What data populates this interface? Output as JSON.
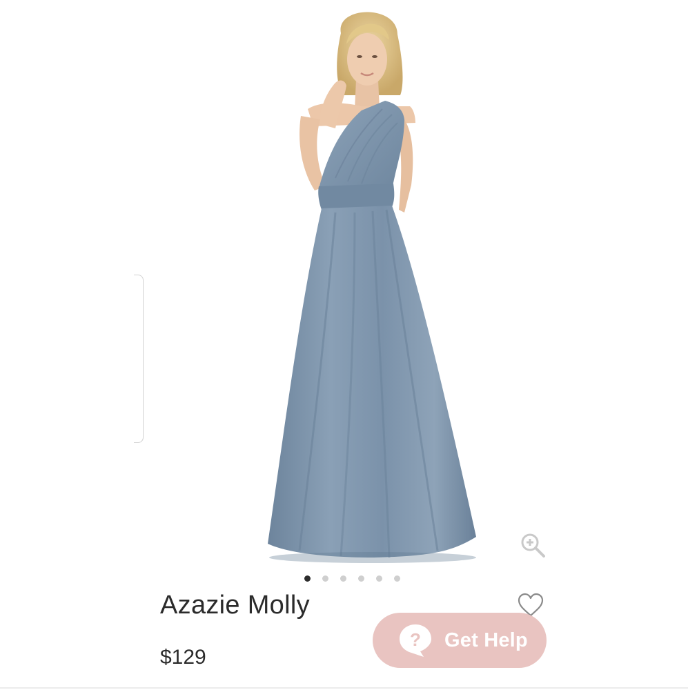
{
  "product": {
    "title": "Azazie Molly",
    "price": "$129",
    "image_alt": "Model wearing dusty blue one-shoulder chiffon bridesmaid dress",
    "image_count": 6,
    "active_image": 1,
    "dress_color": "#7f96ae"
  },
  "help_button": {
    "label": "Get Help",
    "icon": "question-bubble-icon",
    "background": "#e9c4c1"
  },
  "icons": {
    "zoom": "zoom-in-icon",
    "wishlist": "heart-icon"
  }
}
